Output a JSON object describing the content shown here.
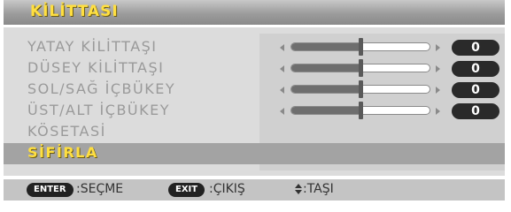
{
  "menu": {
    "title": "KİLİTTASI",
    "items": [
      {
        "label": "YATAY KİLİTTAŞI",
        "value": "0",
        "level": 0.5
      },
      {
        "label": "DÜSEY KİLİTTAŞI",
        "value": "0",
        "level": 0.5
      },
      {
        "label": "SOL/SAĞ İÇBÜKEY",
        "value": "0",
        "level": 0.5
      },
      {
        "label": "ÜST/ALT İÇBÜKEY",
        "value": "0",
        "level": 0.5
      },
      {
        "label": "KÖSETASİ"
      },
      {
        "label": "SİFİRLA",
        "selected": true
      }
    ]
  },
  "footer": {
    "enter_key": "ENTER",
    "enter_label": ":SEÇME",
    "exit_key": "EXIT",
    "exit_label": ":ÇIKIŞ",
    "move_icon": "up-down-icon",
    "move_label": ":TAŞI"
  },
  "colors": {
    "title_text": "#ffdf40",
    "selected_text": "#ffdf40",
    "item_text": "#9a9a9a",
    "panel_bg": "#dcdcdc",
    "selected_bg": "#a3a3a3",
    "value_pill_bg": "#2a2a2a"
  }
}
